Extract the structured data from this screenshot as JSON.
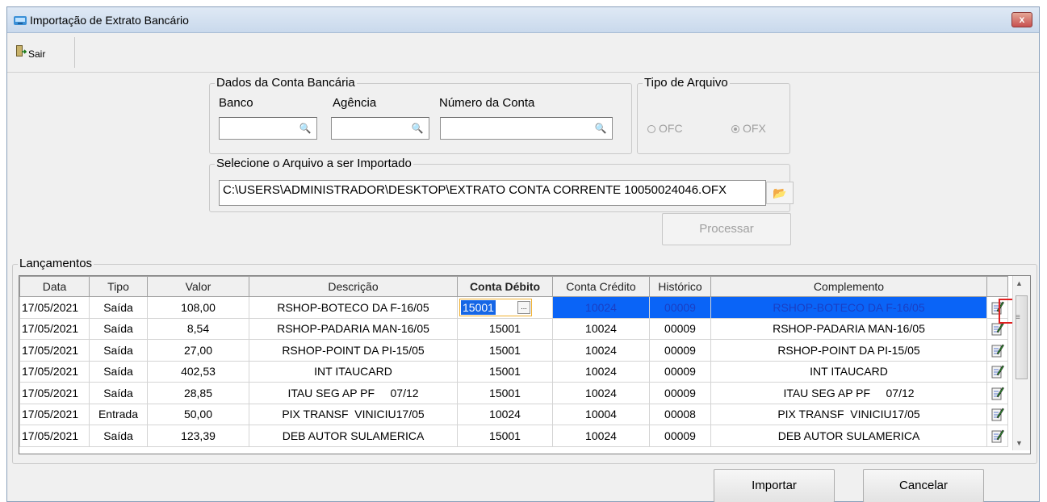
{
  "window": {
    "title": "Importação de Extrato Bancário",
    "close_label": "x"
  },
  "toolbar": {
    "sair_label": "Sair"
  },
  "conta": {
    "legend": "Dados da Conta Bancária",
    "banco_label": "Banco",
    "agencia_label": "Agência",
    "numero_label": "Número da Conta",
    "banco_value": "",
    "agencia_value": "",
    "numero_value": ""
  },
  "tipo_arquivo": {
    "legend": "Tipo de Arquivo",
    "options": [
      {
        "label": "OFC",
        "selected": false
      },
      {
        "label": "OFX",
        "selected": true
      }
    ]
  },
  "arquivo": {
    "legend": "Selecione o Arquivo a ser Importado",
    "path": "C:\\USERS\\ADMINISTRADOR\\DESKTOP\\EXTRATO CONTA CORRENTE 10050024046.OFX"
  },
  "processar_label": "Processar",
  "lancamentos": {
    "legend": "Lançamentos",
    "columns": [
      "Data",
      "Tipo",
      "Valor",
      "Descrição",
      "Conta Débito",
      "Conta Crédito",
      "Histórico",
      "Complemento"
    ],
    "rows": [
      {
        "data": "17/05/2021",
        "tipo": "Saída",
        "valor": "108,00",
        "descricao": "RSHOP-BOTECO DA F-16/05",
        "debito": "15001",
        "credito": "10024",
        "historico": "00009",
        "complemento": "RSHOP-BOTECO DA F-16/05"
      },
      {
        "data": "17/05/2021",
        "tipo": "Saída",
        "valor": "8,54",
        "descricao": "RSHOP-PADARIA MAN-16/05",
        "debito": "15001",
        "credito": "10024",
        "historico": "00009",
        "complemento": "RSHOP-PADARIA MAN-16/05"
      },
      {
        "data": "17/05/2021",
        "tipo": "Saída",
        "valor": "27,00",
        "descricao": "RSHOP-POINT DA PI-15/05",
        "debito": "15001",
        "credito": "10024",
        "historico": "00009",
        "complemento": "RSHOP-POINT DA PI-15/05"
      },
      {
        "data": "17/05/2021",
        "tipo": "Saída",
        "valor": "402,53",
        "descricao": "INT ITAUCARD",
        "debito": "15001",
        "credito": "10024",
        "historico": "00009",
        "complemento": "INT ITAUCARD"
      },
      {
        "data": "17/05/2021",
        "tipo": "Saída",
        "valor": "28,85",
        "descricao": "ITAU SEG AP PF     07/12",
        "debito": "15001",
        "credito": "10024",
        "historico": "00009",
        "complemento": "ITAU SEG AP PF     07/12"
      },
      {
        "data": "17/05/2021",
        "tipo": "Entrada",
        "valor": "50,00",
        "descricao": "PIX TRANSF  VINICIU17/05",
        "debito": "10024",
        "credito": "10004",
        "historico": "00008",
        "complemento": "PIX TRANSF  VINICIU17/05"
      },
      {
        "data": "17/05/2021",
        "tipo": "Saída",
        "valor": "123,39",
        "descricao": "DEB AUTOR SULAMERICA",
        "debito": "15001",
        "credito": "10024",
        "historico": "00009",
        "complemento": "DEB AUTOR SULAMERICA"
      }
    ]
  },
  "importar_label": "Importar",
  "cancelar_label": "Cancelar",
  "colors": {
    "selection": "#0a64f7",
    "highlight": "#e02020"
  }
}
